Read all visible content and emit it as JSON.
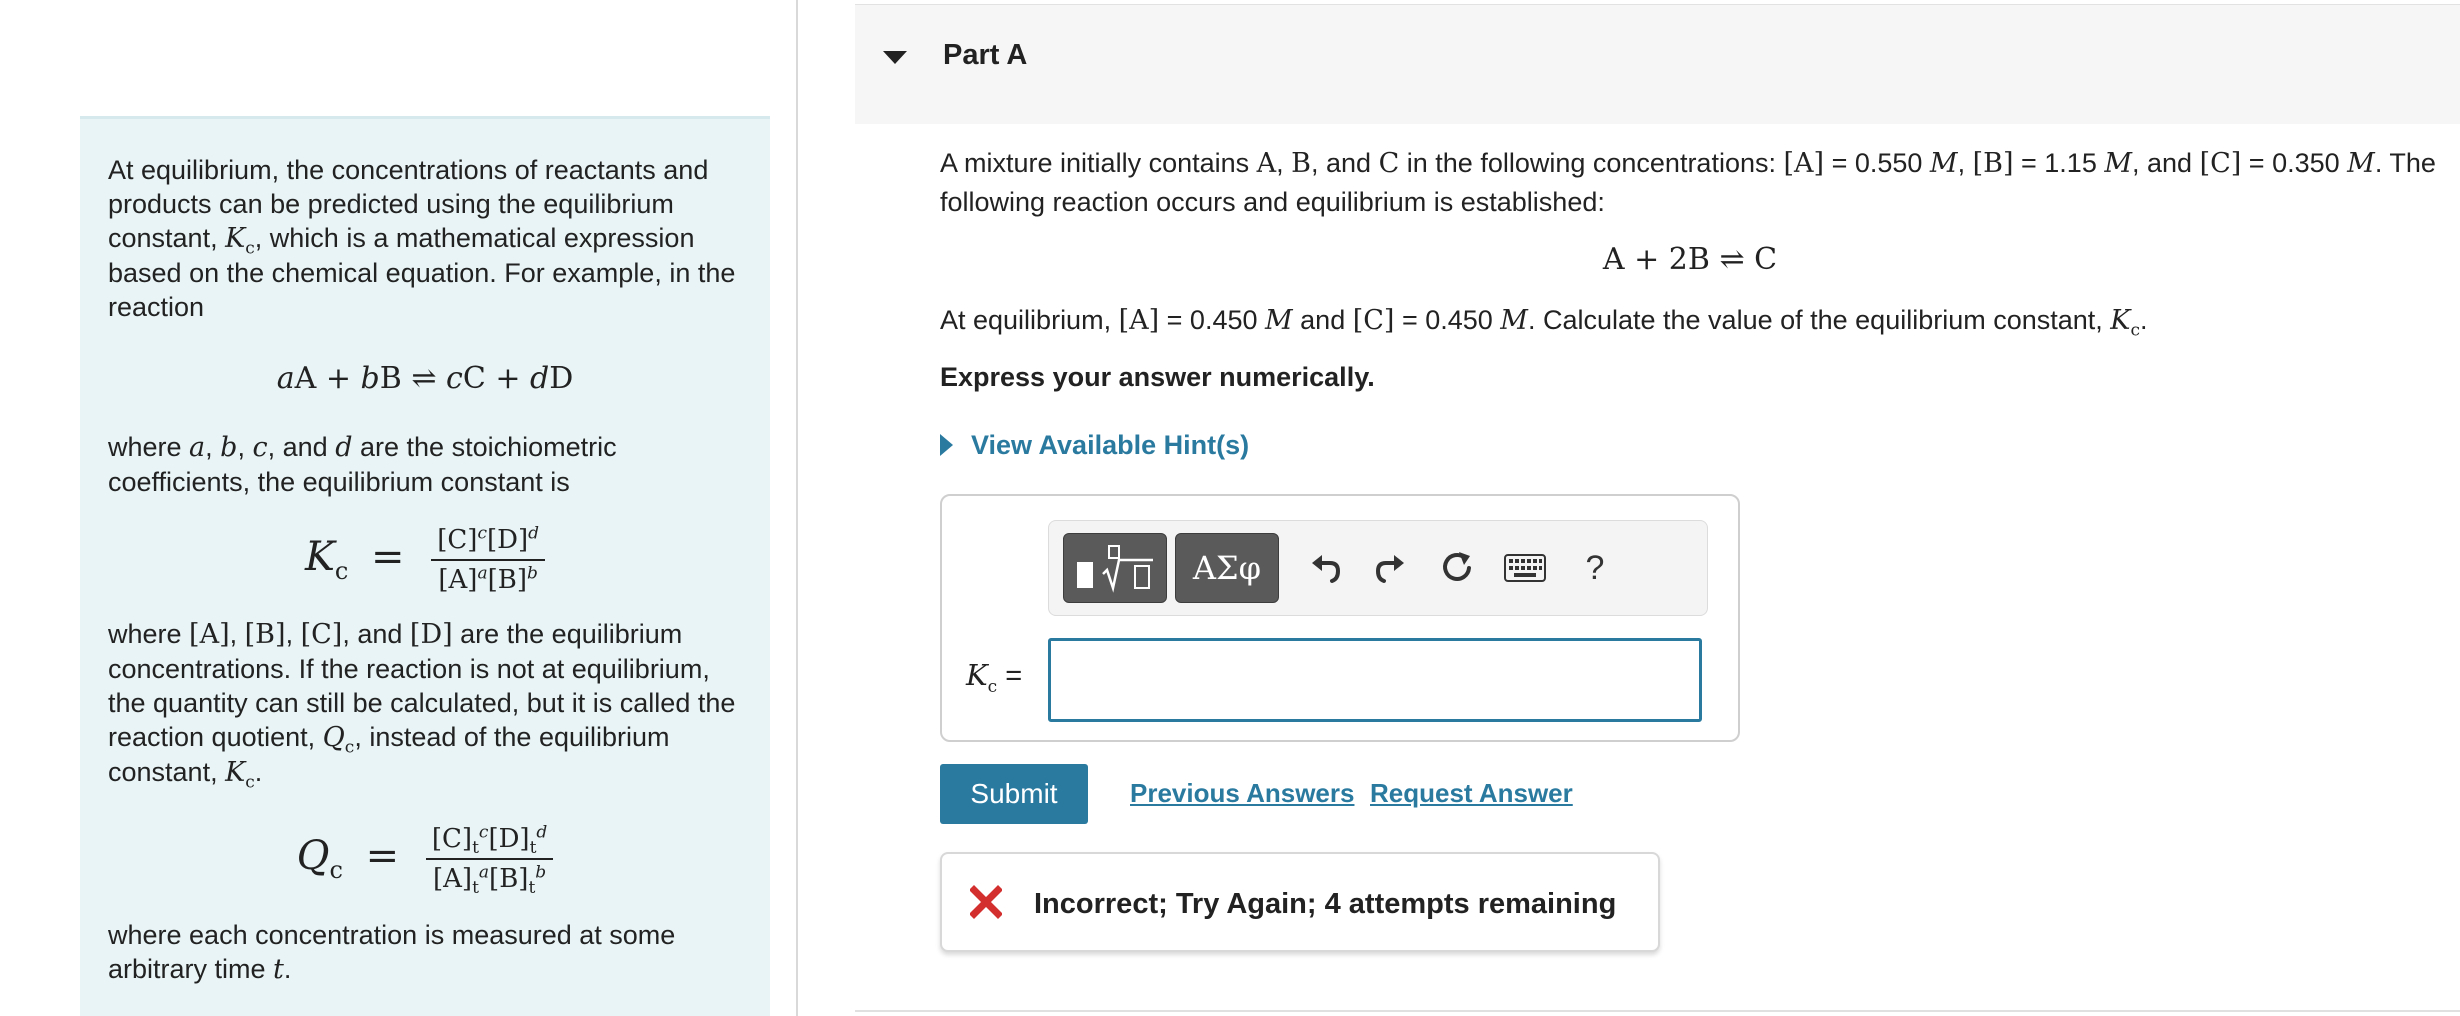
{
  "intro": {
    "p1": "At equilibrium, the concentrations of reactants and products can be predicted using the equilibrium constant, ",
    "p1_sym": "K",
    "p1_sub": "c",
    "p1_end": ", which is a mathematical expression based on the chemical equation. For example, in the reaction",
    "general_eq": {
      "a": "a",
      "A": "A",
      "b": "b",
      "B": "B",
      "c": "c",
      "C": "C",
      "d": "d",
      "D": "D",
      "plus": "+",
      "arrow": "⇌"
    },
    "p2_start": "where ",
    "p2_vars": [
      "a",
      "b",
      "c",
      "d"
    ],
    "p2_and": "and",
    "p2_end": "are the stoichiometric coefficients, the equilibrium constant is",
    "kc_eq": {
      "lhs": "K",
      "lhs_sub": "c",
      "equals": "=",
      "num_C": "[C]",
      "num_C_exp": "c",
      "num_D": "[D]",
      "num_D_exp": "d",
      "den_A": "[A]",
      "den_A_exp": "a",
      "den_B": "[B]",
      "den_B_exp": "b"
    },
    "p3_start": "where ",
    "p3_species": [
      "[A]",
      "[B]",
      "[C]",
      "[D]"
    ],
    "p3_and": "and",
    "p3_mid": " are the equilibrium concentrations. If the reaction is not at equilibrium, the quantity can still be calculated, but it is called the reaction quotient, ",
    "p3_q": "Q",
    "p3_q_sub": "c",
    "p3_mid2": ", instead of the equilibrium constant, ",
    "p3_k": "K",
    "p3_k_sub": "c",
    "p3_end": ".",
    "qc_eq": {
      "lhs": "Q",
      "lhs_sub": "c",
      "equals": "=",
      "t": "t",
      "num_C": "[C]",
      "num_C_exp": "c",
      "num_D": "[D]",
      "num_D_exp": "d",
      "den_A": "[A]",
      "den_A_exp": "a",
      "den_B": "[B]",
      "den_B_exp": "b"
    },
    "p4": "where each concentration is measured at some arbitrary time ",
    "p4_t": "t",
    "p4_end": "."
  },
  "part": {
    "title": "Part A"
  },
  "question": {
    "l1_a": "A mixture initially contains ",
    "species": [
      "A",
      "B",
      "C"
    ],
    "l1_and": "and",
    "l1_b": " in the following concentrations: ",
    "A_init": "[A]",
    "A_init_val": " = 0.550 ",
    "B_init": "[B]",
    "B_init_val": " = 1.15 ",
    "and_word": ", and ",
    "C_init": "[C]",
    "C_init_val": " = 0.350",
    "M": "M",
    "l2": ". The following reaction occurs and equilibrium is established:",
    "reaction": {
      "A": "A",
      "plus": "+",
      "coef_B": "2B",
      "arrow": "⇌",
      "C": "C"
    },
    "eq_a": "At equilibrium, ",
    "A_eq": "[A]",
    "A_eq_val": " = 0.450 ",
    "eq_and": " and ",
    "C_eq": "[C]",
    "C_eq_val": " = 0.450 ",
    "eq_b": ". Calculate the value of the equilibrium constant, ",
    "K": "K",
    "K_sub": "c",
    "eq_end": ".",
    "instruction": "Express your answer numerically."
  },
  "hint": {
    "label": "View Available Hint(s)"
  },
  "answer": {
    "greek_label": "ΑΣφ",
    "help_label": "?",
    "kc_label": "K",
    "kc_sub": "c",
    "kc_equals": " =",
    "input_value": ""
  },
  "actions": {
    "submit": "Submit",
    "previous": "Previous Answers",
    "request": "Request Answer"
  },
  "feedback": {
    "text": "Incorrect; Try Again; 4 attempts remaining"
  },
  "colors": {
    "accent": "#2a7aa0",
    "intro_bg": "#e8f4f6",
    "error": "#d32f2f"
  }
}
